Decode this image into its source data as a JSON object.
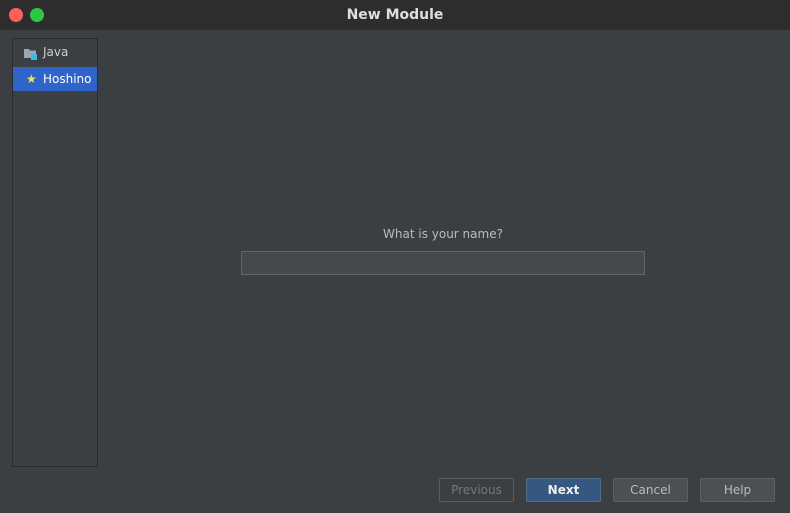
{
  "window": {
    "title": "New Module"
  },
  "sidebar": {
    "items": [
      {
        "label": "Java",
        "icon": "folder-module-icon",
        "selected": false
      },
      {
        "label": "Hoshino",
        "icon": "star-icon",
        "selected": true
      }
    ]
  },
  "form": {
    "prompt": "What is your name?",
    "name_value": "",
    "name_placeholder": ""
  },
  "buttons": {
    "previous": "Previous",
    "next": "Next",
    "cancel": "Cancel",
    "help": "Help"
  },
  "colors": {
    "selection": "#2f65ca",
    "default_button": "#365880",
    "close": "#ff5f57",
    "zoom": "#2ec840"
  }
}
